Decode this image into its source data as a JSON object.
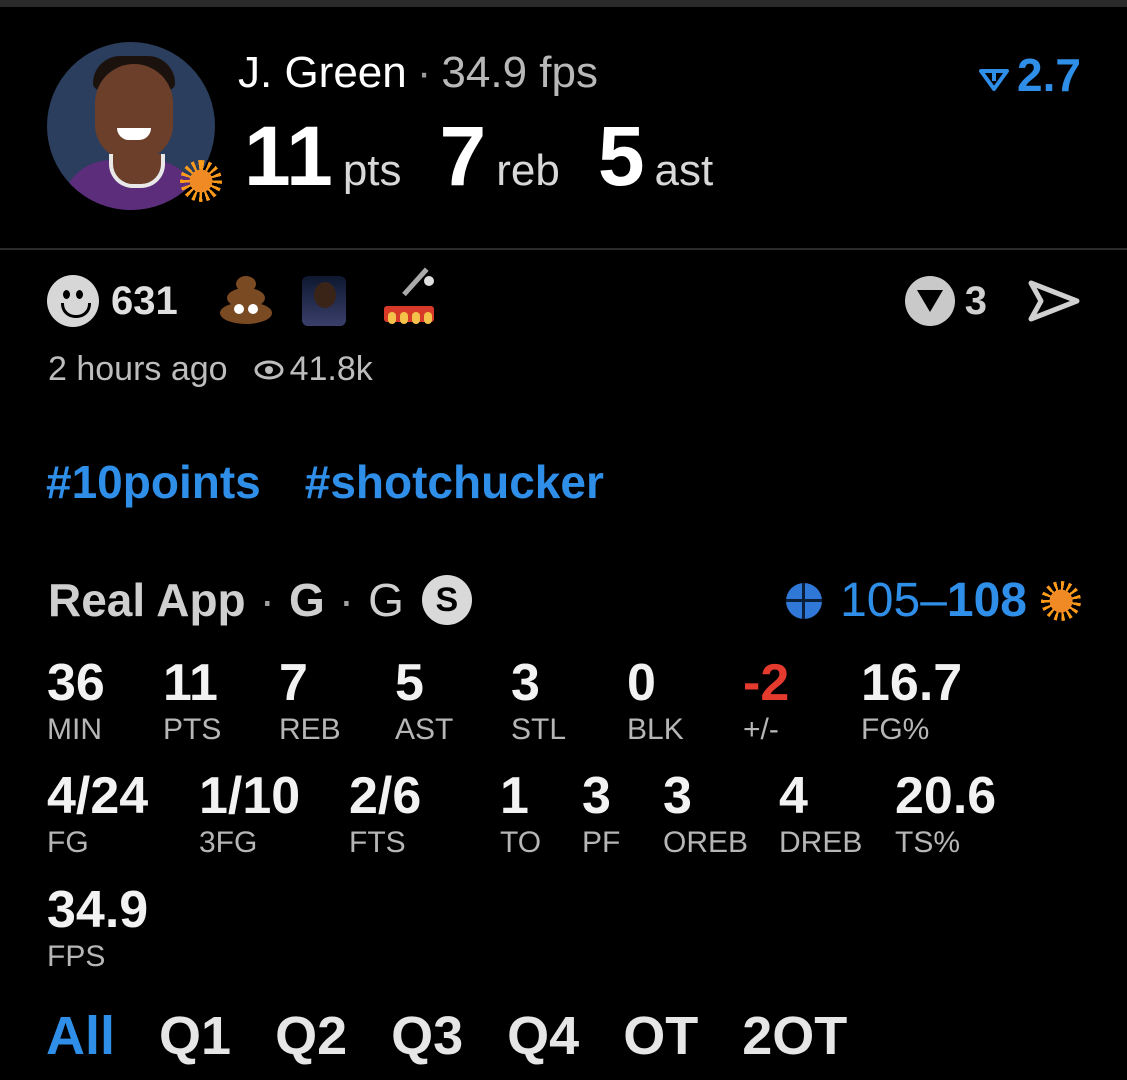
{
  "player": {
    "name": "J. Green",
    "separator": "·",
    "fps": "34.9 fps",
    "pts": "11",
    "pts_label": "pts",
    "reb": "7",
    "reb_label": "reb",
    "ast": "5",
    "ast_label": "ast",
    "trend_value": "2.7"
  },
  "reactions": {
    "smiley_count": "631",
    "items": [
      "smiley-icon",
      "poop-emoji",
      "player-photo",
      "lever-emoji"
    ],
    "v_count": "3"
  },
  "meta": {
    "time": "2 hours ago",
    "views": "41.8k"
  },
  "tags": [
    "#10points",
    "#shotchucker"
  ],
  "game": {
    "app": "Real App",
    "sep": "·",
    "pos1": "G",
    "pos2": "G",
    "badge": "S",
    "score_away": "105",
    "score_dash": "–",
    "score_home": "108"
  },
  "stats_row1": [
    {
      "v": "36",
      "l": "MIN"
    },
    {
      "v": "11",
      "l": "PTS"
    },
    {
      "v": "7",
      "l": "REB"
    },
    {
      "v": "5",
      "l": "AST"
    },
    {
      "v": "3",
      "l": "STL"
    },
    {
      "v": "0",
      "l": "BLK"
    },
    {
      "v": "-2",
      "l": "+/-"
    },
    {
      "v": "16.7",
      "l": "FG%"
    }
  ],
  "stats_row2": [
    {
      "v": "4/24",
      "l": "FG"
    },
    {
      "v": "1/10",
      "l": "3FG"
    },
    {
      "v": "2/6",
      "l": "FTS"
    },
    {
      "v": "1",
      "l": "TO"
    },
    {
      "v": "3",
      "l": "PF"
    },
    {
      "v": "3",
      "l": "OREB"
    },
    {
      "v": "4",
      "l": "DREB"
    },
    {
      "v": "20.6",
      "l": "TS%"
    }
  ],
  "stats_row3": [
    {
      "v": "34.9",
      "l": "FPS"
    }
  ],
  "periods": [
    "All",
    "Q1",
    "Q2",
    "Q3",
    "Q4",
    "OT",
    "2OT"
  ],
  "colors": {
    "accent": "#2f8fe8",
    "negative": "#e53a2e",
    "background": "#000000"
  }
}
